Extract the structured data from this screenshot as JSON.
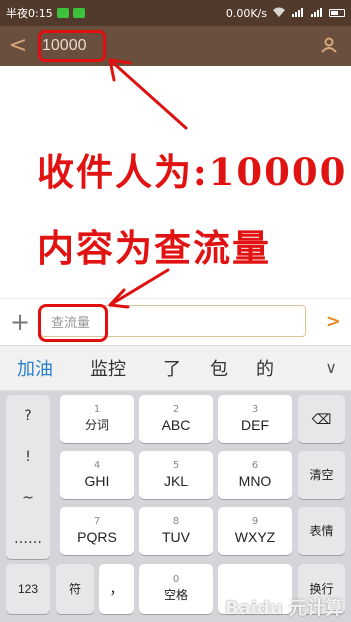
{
  "status_bar": {
    "time": "半夜0:15",
    "speed": "0.00K/s"
  },
  "header": {
    "back_icon": "<",
    "recipient": "10000"
  },
  "annotation": {
    "line1": "收件人为:10000",
    "line2": "内容为查流量"
  },
  "composer": {
    "plus_icon": "+",
    "message": "查流量",
    "send_icon": ">"
  },
  "candidates": {
    "items": [
      "加油",
      "监控",
      "了",
      "包",
      "的"
    ],
    "collapse_icon": "∨"
  },
  "keyboard": {
    "side_keys": [
      "?",
      "!",
      "~",
      "……"
    ],
    "keys": [
      {
        "num": "1",
        "label": "分词"
      },
      {
        "num": "2",
        "label": "ABC"
      },
      {
        "num": "3",
        "label": "DEF"
      },
      {
        "num": "4",
        "label": "GHI"
      },
      {
        "num": "5",
        "label": "JKL"
      },
      {
        "num": "6",
        "label": "MNO"
      },
      {
        "num": "7",
        "label": "PQRS"
      },
      {
        "num": "8",
        "label": "TUV"
      },
      {
        "num": "9",
        "label": "WXYZ"
      }
    ],
    "backspace_icon": "⌫",
    "clear_label": "清空",
    "emoji_label": "表情",
    "bottom": {
      "k123": "123",
      "symbol": "符",
      "comma": "，",
      "zero_num": "0",
      "space_label": "空格",
      "enter_label": "换行"
    }
  },
  "watermark": "Baidu 元计算"
}
